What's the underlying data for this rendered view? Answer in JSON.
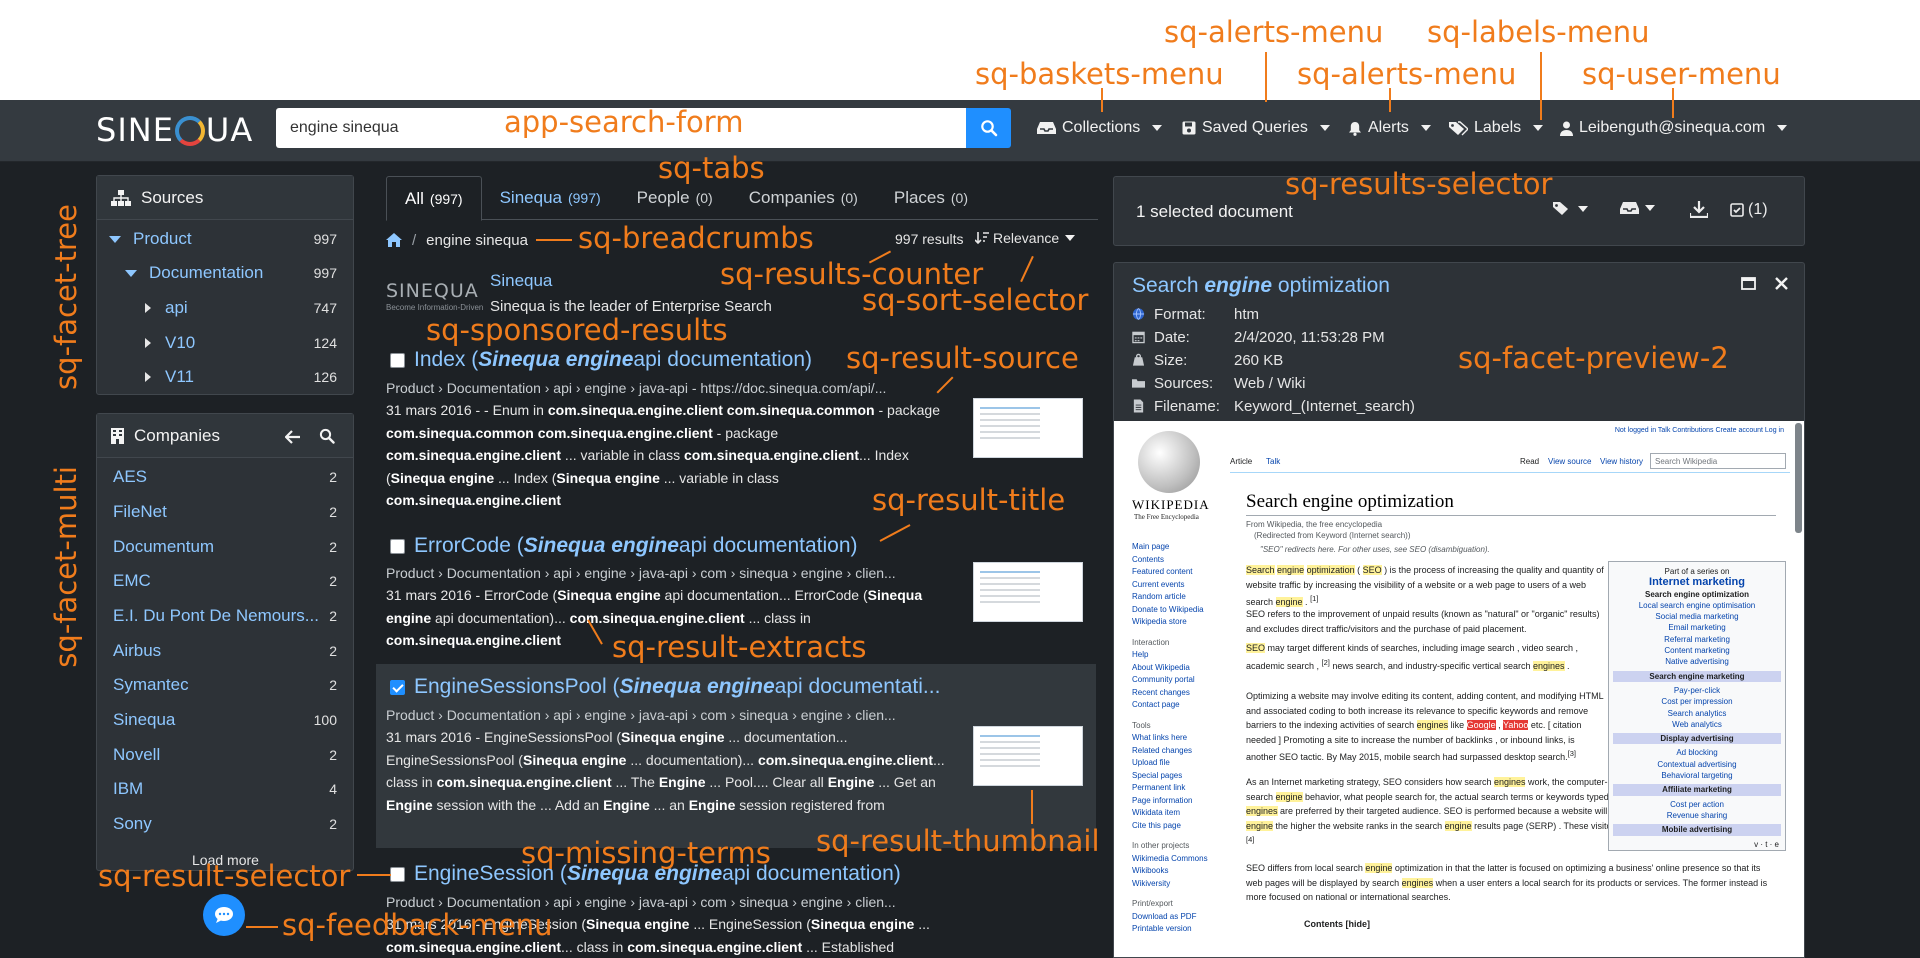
{
  "annotations": {
    "app_search_form": "app-search-form",
    "sq_baskets_menu": "sq-baskets-menu",
    "sq_alerts_menu_1": "sq-alerts-menu",
    "sq_alerts_menu_2": "sq-alerts-menu",
    "sq_labels_menu": "sq-labels-menu",
    "sq_user_menu": "sq-user-menu",
    "sq_tabs": "sq-tabs",
    "sq_breadcrumbs": "sq-breadcrumbs",
    "sq_results_counter": "sq-results-counter",
    "sq_sort_selector": "sq-sort-selector",
    "sq_sponsored_results": "sq-sponsored-results",
    "sq_result_source": "sq-result-source",
    "sq_result_title": "sq-result-title",
    "sq_result_extracts": "sq-result-extracts",
    "sq_result_thumbnail": "sq-result-thumbnail",
    "sq_missing_terms": "sq-missing-terms",
    "sq_result_selector": "sq-result-selector",
    "sq_feedback_menu": "sq-feedback-menu",
    "sq_results_selector": "sq-results-selector",
    "sq_facet_preview_2": "sq-facet-preview-2",
    "sq_facet_tree": "sq-facet-tree",
    "sq_facet_multi": "sq-facet-multi"
  },
  "navbar": {
    "logo_pre": "SINE",
    "logo_post": "UA",
    "search_value": "engine sinequa",
    "menus": {
      "collections": "Collections",
      "saved_queries": "Saved Queries",
      "alerts": "Alerts",
      "labels": "Labels",
      "user": "Leibenguth@sinequa.com"
    }
  },
  "sources": {
    "title": "Sources",
    "items": [
      {
        "label": "Product",
        "count": "997"
      },
      {
        "label": "Documentation",
        "count": "997"
      },
      {
        "label": "api",
        "count": "747"
      },
      {
        "label": "V10",
        "count": "124"
      },
      {
        "label": "V11",
        "count": "126"
      }
    ]
  },
  "companies": {
    "title": "Companies",
    "items": [
      {
        "label": "AES",
        "count": "2"
      },
      {
        "label": "FileNet",
        "count": "2"
      },
      {
        "label": "Documentum",
        "count": "2"
      },
      {
        "label": "EMC",
        "count": "2"
      },
      {
        "label": "E.I. Du Pont De Nemours...",
        "count": "2"
      },
      {
        "label": "Airbus",
        "count": "2"
      },
      {
        "label": "Symantec",
        "count": "2"
      },
      {
        "label": "Sinequa",
        "count": "100"
      },
      {
        "label": "Novell",
        "count": "2"
      },
      {
        "label": "IBM",
        "count": "4"
      },
      {
        "label": "Sony",
        "count": "2"
      }
    ],
    "load_more": "Load more"
  },
  "tabs": [
    {
      "label": "All",
      "count": "(997)"
    },
    {
      "label": "Sinequa",
      "count": "(997)"
    },
    {
      "label": "People",
      "count": "(0)"
    },
    {
      "label": "Companies",
      "count": "(0)"
    },
    {
      "label": "Places",
      "count": "(0)"
    }
  ],
  "breadcrumb": {
    "query": "engine sinequa",
    "separator": "/"
  },
  "results_counter": "997 results",
  "sort": "Relevance",
  "sponsored": {
    "logo": "SINEQUA",
    "tagline": "Become Information-Driven",
    "title": "Sinequa",
    "desc": "Sinequa is the leader of Enterprise Search"
  },
  "results": [
    {
      "title_pre": "Index (",
      "title_em": "Sinequa engine",
      "title_post": " api documentation)",
      "source": "Product › Documentation › api › engine › java-api - https://doc.sinequa.com/api/...",
      "extract_html": "31 mars 2016 - - Enum in <b>com.sinequa.engine.client com.sinequa.common</b> - package <b>com.sinequa.common com.sinequa.engine.client</b> - package <b>com.sinequa.engine.client</b> ... variable in class <b>com.sinequa.engine.client</b>... Index (<b>Sinequa engine</b> ... Index (<b>Sinequa engine</b> ... variable in class <b>com.sinequa.engine.client</b>"
    },
    {
      "title_pre": "ErrorCode (",
      "title_em": "Sinequa engine",
      "title_post": " api documentation)",
      "source": "Product › Documentation › api › engine › java-api › com › sinequa › engine › clien...",
      "extract_html": "31 mars 2016 - ErrorCode (<b>Sinequa engine</b> api documentation... ErrorCode (<b>Sinequa engine</b> api documentation)... <b>com.sinequa.engine.client</b> ... class in <b>com.sinequa.engine.client</b>"
    },
    {
      "title_pre": "EngineSessionsPool (",
      "title_em": "Sinequa engine",
      "title_post": " api documentati...",
      "source": "Product › Documentation › api › engine › java-api › com › sinequa › engine › clien...",
      "extract_html": "31 mars 2016 - EngineSessionsPool (<b>Sinequa engine</b> ... documentation... EngineSessionsPool (<b>Sinequa engine</b> ... documentation)... <b>com.sinequa.engine.client</b>... class in <b>com.sinequa.engine.client</b> ... The <b>Engine</b> ... Pool.... Clear all <b>Engine</b> ... Get an <b>Engine</b> session with the ... Add an <b>Engine</b> ... an <b>Engine</b> session registered from"
    },
    {
      "title_pre": "EngineSession (",
      "title_em": "Sinequa engine",
      "title_post": " api documentation)",
      "source": "Product › Documentation › api › engine › java-api › com › sinequa › engine › clien...",
      "extract_html": "31 mars 2016 - EngineSession (<b>Sinequa engine</b> ... EngineSession (<b>Sinequa engine</b> ... <b>com.sinequa.engine.client</b>... class in <b>com.sinequa.engine.client</b> ... Established"
    }
  ],
  "selection": {
    "text": "1 selected document",
    "count": "(1)"
  },
  "preview": {
    "title_pre": "Search ",
    "title_em": "engine",
    "title_post": " optimization",
    "meta": [
      {
        "key": "Format:",
        "value": "htm"
      },
      {
        "key": "Date:",
        "value": "2/4/2020, 11:53:28 PM"
      },
      {
        "key": "Size:",
        "value": "260 KB"
      },
      {
        "key": "Sources:",
        "value": "Web / Wiki"
      },
      {
        "key": "Filename:",
        "value": "Keyword_(Internet_search)"
      }
    ]
  },
  "wiki": {
    "top_links": "Not logged in   Talk   Contributions   Create account   Log in",
    "logo": "WIKIPEDIA",
    "logo_sub": "The Free Encyclopedia",
    "tab_article": "Article",
    "tab_talk": "Talk",
    "tab_read": "Read",
    "tab_view_source": "View source",
    "tab_view_history": "View history",
    "search_placeholder": "Search Wikipedia",
    "heading": "Search engine optimization",
    "from": "From Wikipedia, the free encyclopedia",
    "redirected": "(Redirected from Keyword (Internet search))",
    "hatnote": "\"SEO\" redirects here. For other uses, see SEO (disambiguation).",
    "side_links": [
      "Main page",
      "Contents",
      "Featured content",
      "Current events",
      "Random article",
      "Donate to Wikipedia",
      "Wikipedia store"
    ],
    "side_interaction_head": "Interaction",
    "side_interaction": [
      "Help",
      "About Wikipedia",
      "Community portal",
      "Recent changes",
      "Contact page"
    ],
    "side_tools_head": "Tools",
    "side_tools": [
      "What links here",
      "Related changes",
      "Upload file",
      "Special pages",
      "Permanent link",
      "Page information",
      "Wikidata item",
      "Cite this page"
    ],
    "side_other_head": "In other projects",
    "side_other": [
      "Wikimedia Commons",
      "Wikibooks",
      "Wikiversity"
    ],
    "side_print_head": "Print/export",
    "side_print": [
      "Download as PDF",
      "Printable version"
    ],
    "p1_html": "<span class=\"hl\">Search</span> <span class=\"hl\">engine</span> <span class=\"hl\">optimization</span> ( <span class=\"hl\">SEO</span> ) is the process of increasing the quality and quantity of website traffic by increasing the visibility of a website or a web page to users of a web search <span class=\"hl\">engine</span> . <sup>[1]</sup>",
    "p2_html": "SEO refers to the improvement of unpaid results (known as \"natural\" or \"organic\" results) and excludes direct traffic/visitors and the purchase of paid placement.",
    "p3_html": "<span class=\"hl\">SEO</span> may target different kinds of searches, including image search , video search , academic search , <sup>[2]</sup> news search, and industry-specific vertical search <span class=\"hl\">engines</span> .",
    "p4_html": "Optimizing a website may involve editing its content, adding content, and modifying HTML and associated coding to both increase its relevance to specific keywords and remove barriers to the indexing activities of search <span class=\"hl\">engines</span> like <span class=\"hlr\">Google</span> , <span class=\"hlr\">Yahoo</span> etc. [ citation needed ] Promoting a site to increase the number of backlinks , or inbound links, is another SEO tactic. By May 2015, mobile search had surpassed desktop search.<sup>[3]</sup>",
    "p5_html": "As an Internet marketing strategy, SEO considers how search <span class=\"hl\">engines</span> work, the computer-programmed algorithms that dictate search <span class=\"hl\">engine</span> behavior, what people search for, the actual search terms or keywords typed into search <span class=\"hl\">engines</span> , and which search <span class=\"hl\">engines</span> are preferred by their targeted audience. SEO is performed because a website will receive more visitors from a search <span class=\"hl\">engine</span> the higher the website ranks in the search <span class=\"hl\">engine</span> results page (SERP) . These visitors can then be converted into customers.<sup>[4]</sup>",
    "p6_html": "SEO differs from local search <span class=\"hl\">engine</span> optimization in that the latter is focused on optimizing a business' online presence so that its web pages will be displayed by search <span class=\"hl\">engines</span> when a user enters a local search for its products or services. The former instead is more focused on national or international searches.",
    "contents": "Contents [hide]",
    "box": {
      "series": "Part of a series on",
      "title": "Internet marketing",
      "sub": "Search engine optimization",
      "items1": [
        "Local search engine optimisation",
        "Social media marketing",
        "Email marketing",
        "Referral marketing",
        "Content marketing",
        "Native advertising"
      ],
      "h2": "Search engine marketing",
      "items2": [
        "Pay-per-click",
        "Cost per impression",
        "Search analytics",
        "Web analytics"
      ],
      "h3": "Display advertising",
      "items3": [
        "Ad blocking",
        "Contextual advertising",
        "Behavioral targeting"
      ],
      "h4": "Affiliate marketing",
      "items4": [
        "Cost per action",
        "Revenue sharing"
      ],
      "h5": "Mobile advertising",
      "vte": "v · t · e"
    }
  }
}
